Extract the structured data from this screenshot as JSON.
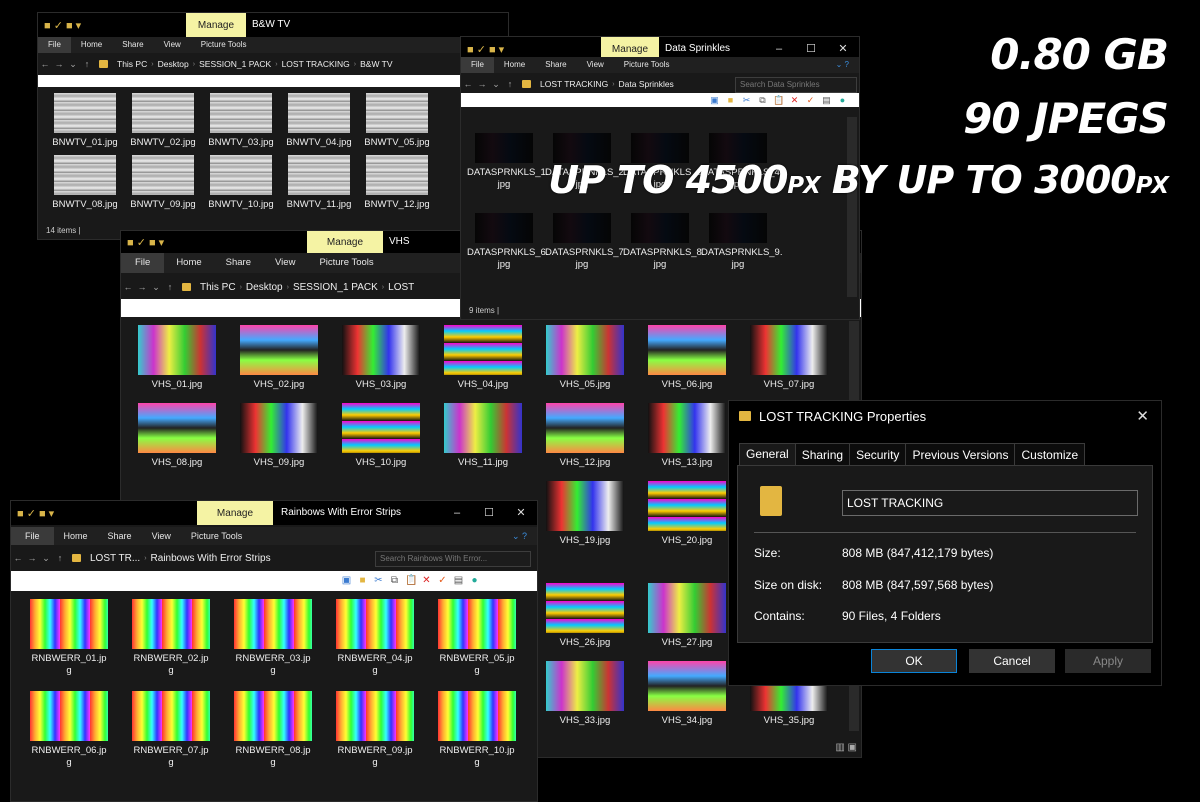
{
  "colors": {
    "bg": "#000000",
    "window": "#191919",
    "manage": "#f5f3a4",
    "folder": "#e3b641",
    "accent": "#0a84d8"
  },
  "explorer": {
    "tabs": [
      "File",
      "Home",
      "Share",
      "View",
      "Picture Tools"
    ],
    "manage_label": "Manage",
    "win_controls": [
      "–",
      "☐",
      "✕"
    ]
  },
  "bw": {
    "title": "B&W TV",
    "path": [
      "This PC",
      "Desktop",
      "SESSION_1 PACK",
      "LOST TRACKING",
      "B&W TV"
    ],
    "items": [
      "BNWTV_01.jpg",
      "BNWTV_02.jpg",
      "BNWTV_03.jpg",
      "BNWTV_04.jpg",
      "BNWTV_05.jpg",
      "BNWTV_08.jpg",
      "BNWTV_09.jpg",
      "BNWTV_10.jpg",
      "BNWTV_11.jpg",
      "BNWTV_12.jpg"
    ],
    "status": "14 items"
  },
  "ds": {
    "title": "Data Sprinkles",
    "path": [
      "LOST TRACKING",
      "Data Sprinkles"
    ],
    "search_placeholder": "Search Data Sprinkles",
    "items": [
      [
        "DATASPRNKLS_1.",
        "jpg"
      ],
      [
        "DATASPRNKLS_2.",
        "jpg"
      ],
      [
        "DATASPRNKLS_3.",
        "jpg"
      ],
      [
        "DATASPRNKLS_4.",
        "jpg"
      ],
      [
        "DATASPRNKLS_6.",
        "jpg"
      ],
      [
        "DATASPRNKLS_7.",
        "jpg"
      ],
      [
        "DATASPRNKLS_8.",
        "jpg"
      ],
      [
        "DATASPRNKLS_9.",
        "jpg"
      ]
    ],
    "status": "9 items"
  },
  "vhs": {
    "title": "VHS",
    "path": [
      "This PC",
      "Desktop",
      "SESSION_1 PACK",
      "LOST"
    ],
    "row1": [
      "VHS_01.jpg",
      "VHS_02.jpg",
      "VHS_03.jpg",
      "VHS_04.jpg",
      "VHS_05.jpg",
      "VHS_06.jpg",
      "VHS_07.jpg"
    ],
    "row2": [
      "VHS_08.jpg",
      "VHS_09.jpg",
      "VHS_10.jpg",
      "VHS_11.jpg",
      "VHS_12.jpg",
      "VHS_13.jpg"
    ],
    "row3": [
      "VHS_19.jpg",
      "VHS_20.jpg"
    ],
    "row4": [
      "VHS_26.jpg",
      "VHS_27.jpg"
    ],
    "row5": [
      "VHS_33.jpg",
      "VHS_34.jpg",
      "VHS_35.jpg"
    ]
  },
  "rb": {
    "title": "Rainbows With Error Strips",
    "path": [
      "LOST TR...",
      "Rainbows With Error Strips"
    ],
    "search_placeholder": "Search Rainbows With Error...",
    "items": [
      [
        "RNBWERR_01.jp",
        "g"
      ],
      [
        "RNBWERR_02.jp",
        "g"
      ],
      [
        "RNBWERR_03.jp",
        "g"
      ],
      [
        "RNBWERR_04.jp",
        "g"
      ],
      [
        "RNBWERR_05.jp",
        "g"
      ],
      [
        "RNBWERR_06.jp",
        "g"
      ],
      [
        "RNBWERR_07.jp",
        "g"
      ],
      [
        "RNBWERR_08.jp",
        "g"
      ],
      [
        "RNBWERR_09.jp",
        "g"
      ],
      [
        "RNBWERR_10.jp",
        "g"
      ]
    ]
  },
  "props": {
    "title": "LOST TRACKING Properties",
    "tabs": [
      "General",
      "Sharing",
      "Security",
      "Previous Versions",
      "Customize"
    ],
    "name": "LOST TRACKING",
    "size_label": "Size:",
    "size_value": "808 MB (847,412,179 bytes)",
    "disk_label": "Size on disk:",
    "disk_value": "808 MB (847,597,568 bytes)",
    "contains_label": "Contains:",
    "contains_value": "90 Files, 4 Folders",
    "ok": "OK",
    "cancel": "Cancel",
    "apply": "Apply"
  },
  "promo": {
    "line1": "0.80 GB",
    "line2": "90 JPEGS",
    "line3a": "UP TO 4500",
    "line3b": "PX",
    "line3c": " BY UP TO  3000",
    "line3d": "PX"
  }
}
